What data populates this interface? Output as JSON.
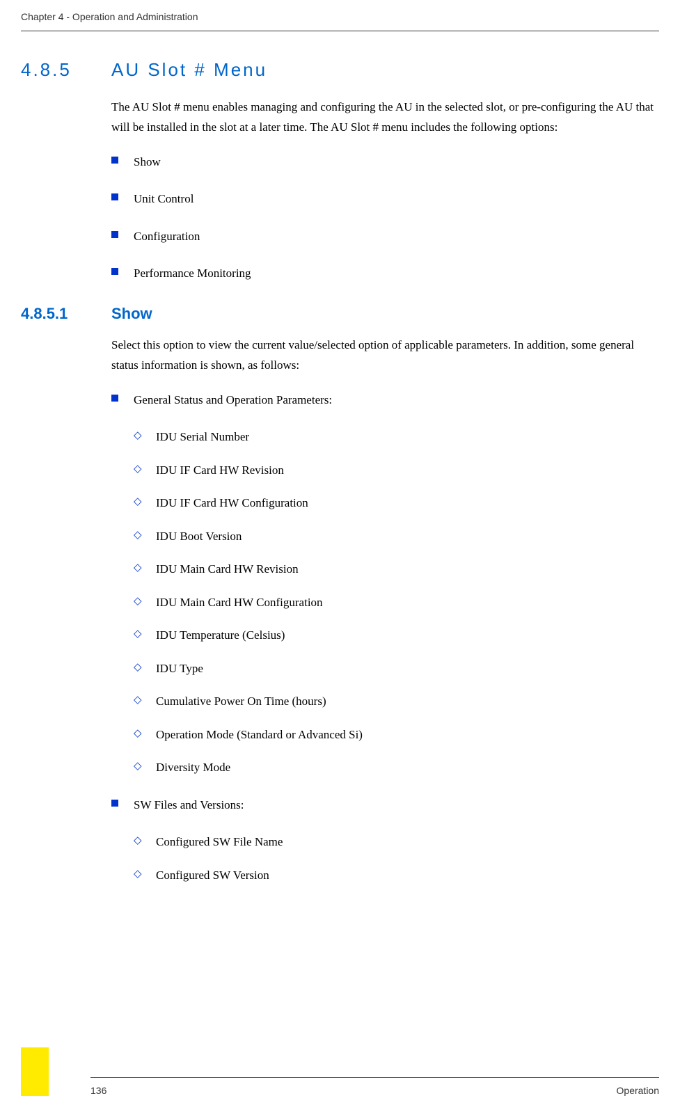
{
  "header": {
    "chapter_label": "Chapter 4 - Operation and Administration"
  },
  "section_485": {
    "number": "4.8.5",
    "title": "AU Slot # Menu",
    "intro": "The AU Slot # menu enables managing and configuring the AU in the selected slot, or pre-configuring the AU that will be installed in the slot at a later time. The AU Slot # menu includes the following options:",
    "options": [
      "Show",
      "Unit Control",
      "Configuration",
      "Performance Monitoring"
    ]
  },
  "section_4851": {
    "number": "4.8.5.1",
    "title": "Show",
    "intro": "Select this option to view the current value/selected option of applicable parameters. In addition, some general status information is shown, as follows:",
    "groups": [
      {
        "label": "General Status and Operation Parameters:",
        "items": [
          "IDU Serial Number",
          "IDU IF Card HW Revision",
          "IDU IF Card HW Configuration",
          "IDU Boot Version",
          "IDU Main Card HW Revision",
          "IDU Main Card HW Configuration",
          "IDU Temperature (Celsius)",
          "IDU Type",
          "Cumulative Power On Time (hours)",
          "Operation Mode (Standard or Advanced Si)",
          "Diversity Mode"
        ]
      },
      {
        "label": "SW Files and Versions:",
        "items": [
          "Configured SW File Name",
          "Configured SW Version"
        ]
      }
    ]
  },
  "footer": {
    "page_number": "136",
    "section_label": "Operation"
  }
}
